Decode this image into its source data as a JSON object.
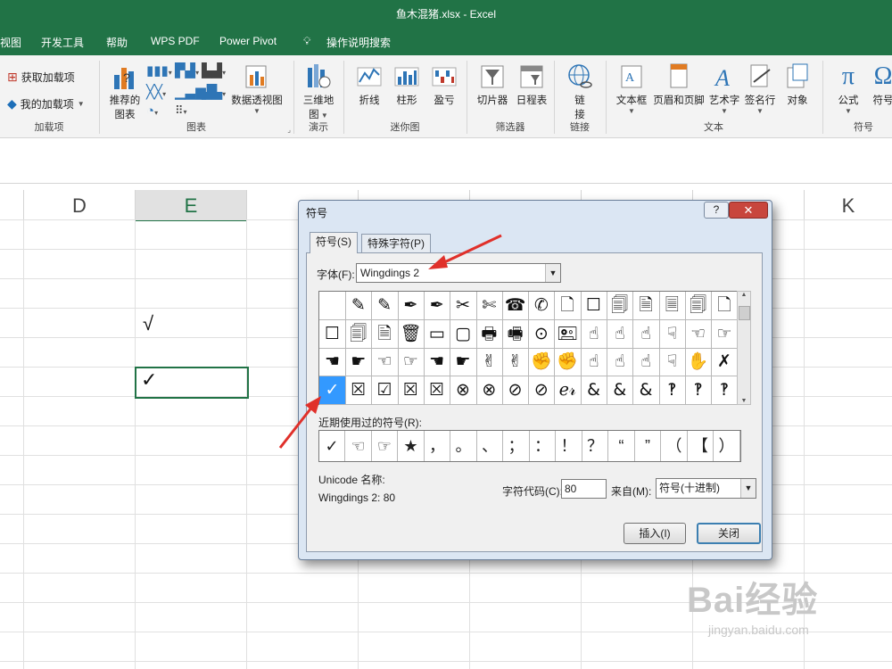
{
  "window": {
    "title": "鱼木混猪.xlsx  -  Excel"
  },
  "menu": [
    "视图",
    "开发工具",
    "帮助",
    "WPS PDF",
    "Power Pivot",
    "操作说明搜索"
  ],
  "ribbon": {
    "addins": {
      "get": "获取加载项",
      "mine": "我的加载项",
      "group": "加载项"
    },
    "charts": {
      "recommended_1": "推荐的",
      "recommended_2": "图表",
      "pivot": "数据透视图",
      "group": "图表"
    },
    "tours": {
      "map_1": "三维地",
      "map_2": "图",
      "group": "演示"
    },
    "sparklines": {
      "line": "折线",
      "column": "柱形",
      "winloss": "盈亏",
      "group": "迷你图"
    },
    "filters": {
      "slicer": "切片器",
      "timeline": "日程表",
      "group": "筛选器"
    },
    "links": {
      "link_1": "链",
      "link_2": "接",
      "group": "链接"
    },
    "text": {
      "textbox": "文本框",
      "headerfooter": "页眉和页脚",
      "wordart": "艺术字",
      "signature": "签名行",
      "object": "对象",
      "group": "文本"
    },
    "symbols": {
      "equation": "公式",
      "symbol": "符号",
      "group": "符号"
    }
  },
  "sheet": {
    "columns": [
      "D",
      "E",
      "K"
    ],
    "cells": [
      {
        "ref": "E4",
        "value": "√"
      },
      {
        "ref": "E6",
        "value": "✓"
      }
    ]
  },
  "dialog": {
    "title": "符号",
    "help": "?",
    "close": "✕",
    "tabs": [
      "符号(S)",
      "特殊字符(P)"
    ],
    "font_label": "字体(F):",
    "font_value": "Wingdings 2",
    "symbols": [
      "",
      "✎",
      "✎",
      "✒",
      "✒",
      "✂",
      "✄",
      "☎",
      "✆",
      "🗋",
      "☐",
      "🗐",
      "🗎",
      "🗏",
      "🗐",
      "🗋",
      "☐",
      "🗐",
      "🗎",
      "🗑",
      "▭",
      "▢",
      "🖶",
      "🖷",
      "⊙",
      "🖭",
      "☝",
      "☝",
      "☝",
      "☟",
      "☜",
      "☞",
      "☚",
      "☛",
      "☜",
      "☞",
      "☚",
      "☛",
      "✌",
      "✌",
      "✊",
      "✊",
      "☝",
      "☝",
      "☝",
      "☟",
      "✋",
      "✗",
      "✓",
      "☒",
      "☑",
      "☒",
      "☒",
      "⊗",
      "⊗",
      "⊘",
      "⊘",
      "ℯ𝓇",
      "&",
      "&",
      "&",
      "‽",
      "‽",
      "‽"
    ],
    "recent_label": "近期使用过的符号(R):",
    "recent": [
      "✓",
      "☜",
      "☞",
      "★",
      "，",
      "。",
      "、",
      "；",
      "：",
      "！",
      "？",
      "“",
      "”",
      "（",
      "【",
      "）"
    ],
    "unicode_label": "Unicode 名称:",
    "unicode_value": "Wingdings 2: 80",
    "code_label": "字符代码(C):",
    "code_value": "80",
    "from_label": "来自(M):",
    "from_value": "符号(十进制)",
    "insert": "插入(I)",
    "close_btn": "关闭"
  },
  "watermark": {
    "logo": "Bai经验",
    "url": "jingyan.baidu.com"
  },
  "colors": {
    "excel_green": "#217346",
    "dialog_frame": "#dbe6f3",
    "arrow_red": "#e0302a",
    "selection_blue": "#3399ff"
  }
}
